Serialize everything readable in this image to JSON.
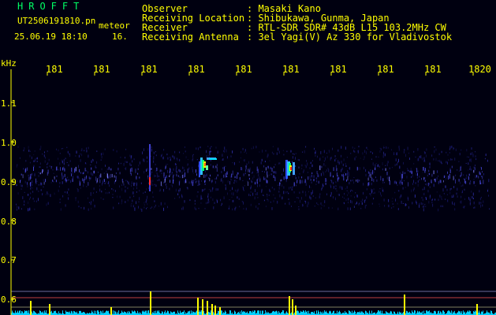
{
  "header": {
    "program": "HROFFT",
    "filename": "UT2506191810.pn",
    "detection_label": "meteor",
    "datetime": "25.06.19 18:10",
    "count": "16."
  },
  "info": [
    {
      "label": "Observer",
      "value": ": Masaki Kano"
    },
    {
      "label": "Receiving Location",
      "value": ": Shibukawa, Gunma, Japan"
    },
    {
      "label": "Receiver",
      "value": ": RTL-SDR SDR# 43dB L15 103.2MHz CW"
    },
    {
      "label": "Receiving Antenna",
      "value": ": 3el Yagi(V) Az 330 for Vladivostok"
    }
  ],
  "axis": {
    "y_unit": "kHz",
    "y_ticks": [
      "1.1",
      "1.0",
      "0.9",
      "0.8",
      "0.7",
      "0.6"
    ],
    "x_ticks": [
      "181",
      "181",
      "181",
      "181",
      "181",
      "181",
      "181",
      "181",
      "181",
      "1820"
    ]
  },
  "colors": {
    "text_yellow": "#ffff00",
    "text_green": "#00ff66",
    "background": "#000010",
    "noise_blue": "#2a2aa0",
    "echo_hot": "#ff3030"
  }
}
